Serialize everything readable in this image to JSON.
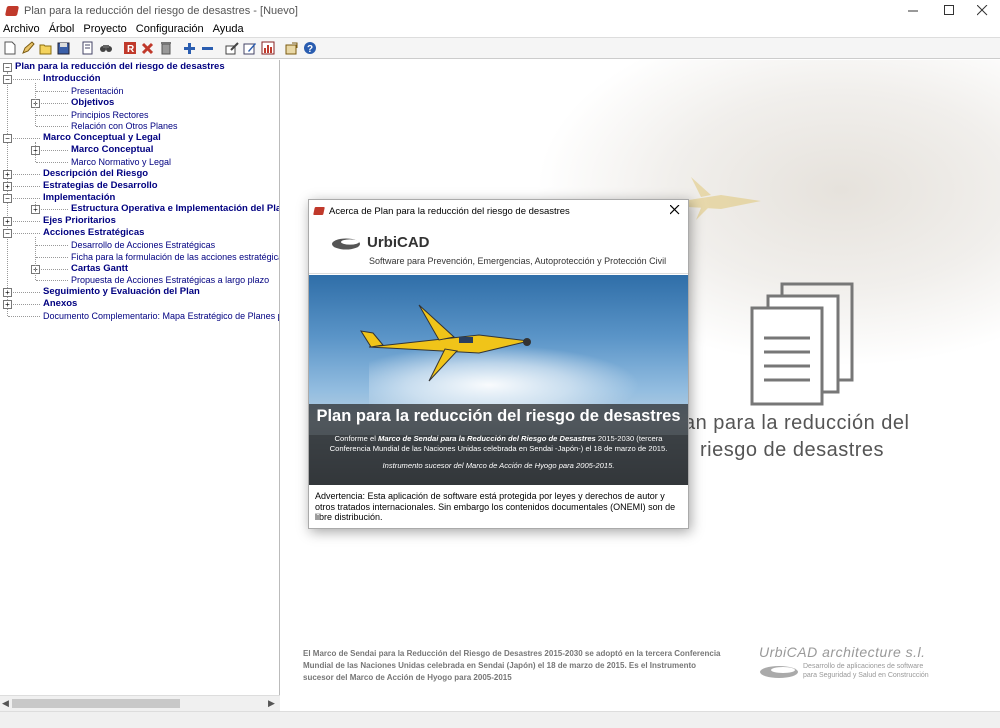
{
  "window": {
    "title": "Plan para la reducción del riesgo de desastres - [Nuevo]"
  },
  "menu": [
    "Archivo",
    "Árbol",
    "Proyecto",
    "Configuración",
    "Ayuda"
  ],
  "toolbar": {
    "buttons": [
      "new-icon",
      "edit-icon",
      "open-icon",
      "save-icon",
      "preview-icon",
      "find-icon",
      "report-icon",
      "delete-icon",
      "trash-icon",
      "add-icon",
      "remove-icon",
      "tool-icon",
      "pencil-icon",
      "chart-icon",
      "export-icon",
      "help-icon"
    ]
  },
  "tree": {
    "root": "Plan para la reducción del riesgo de desastres",
    "items": [
      {
        "label": "Introducción",
        "level": 1,
        "bold": true,
        "expander": "-"
      },
      {
        "label": "Presentación",
        "level": 2,
        "bold": false,
        "expander": ""
      },
      {
        "label": "Objetivos",
        "level": 2,
        "bold": true,
        "expander": "+"
      },
      {
        "label": "Principios Rectores",
        "level": 2,
        "bold": false,
        "expander": ""
      },
      {
        "label": "Relación con Otros Planes",
        "level": 2,
        "bold": false,
        "expander": ""
      },
      {
        "label": "Marco Conceptual y Legal",
        "level": 1,
        "bold": true,
        "expander": "-"
      },
      {
        "label": "Marco Conceptual",
        "level": 2,
        "bold": true,
        "expander": "+"
      },
      {
        "label": "Marco Normativo y Legal",
        "level": 2,
        "bold": false,
        "expander": ""
      },
      {
        "label": "Descripción del Riesgo",
        "level": 1,
        "bold": true,
        "expander": "+"
      },
      {
        "label": "Estrategias de Desarrollo",
        "level": 1,
        "bold": true,
        "expander": "+"
      },
      {
        "label": "Implementación",
        "level": 1,
        "bold": true,
        "expander": "-"
      },
      {
        "label": "Estructura Operativa e Implementación del Plan p",
        "level": 2,
        "bold": true,
        "expander": "+"
      },
      {
        "label": "Ejes Prioritarios",
        "level": 1,
        "bold": true,
        "expander": "+"
      },
      {
        "label": "Acciones Estratégicas",
        "level": 1,
        "bold": true,
        "expander": "-"
      },
      {
        "label": "Desarrollo de Acciones Estratégicas",
        "level": 2,
        "bold": false,
        "expander": ""
      },
      {
        "label": "Ficha para la formulación de las acciones estratégicas",
        "level": 2,
        "bold": false,
        "expander": ""
      },
      {
        "label": "Cartas Gantt",
        "level": 2,
        "bold": true,
        "expander": "+"
      },
      {
        "label": "Propuesta de Acciones Estratégicas a largo plazo",
        "level": 2,
        "bold": false,
        "expander": ""
      },
      {
        "label": "Seguimiento y Evaluación del Plan",
        "level": 1,
        "bold": true,
        "expander": "+"
      },
      {
        "label": "Anexos",
        "level": 1,
        "bold": true,
        "expander": "+"
      },
      {
        "label": "Documento Complementario: Mapa Estratégico de Planes para La G",
        "level": 1,
        "bold": false,
        "expander": ""
      }
    ]
  },
  "background": {
    "title_line1": "an para la reducción del",
    "title_line2": "riesgo de desastres",
    "description": "El Marco de Sendai para la Reducción del Riesgo de Desastres 2015-2030 se adoptó en la tercera Conferencia Mundial de las Naciones Unidas celebrada en Sendai (Japón) el 18 de marzo de 2015. Es el Instrumento sucesor del Marco de Acción de Hyogo para 2005-2015",
    "brand_name": "UrbiCAD architecture s.l.",
    "brand_sub1": "Desarrollo de aplicaciones de software",
    "brand_sub2": "para Seguridad y Salud en Construcción"
  },
  "dialog": {
    "title": "Acerca de Plan para la reducción del riesgo de desastres",
    "brand": "UrbiCAD",
    "slogan": "Software para Prevención, Emergencias, Autoprotección y Protección Civil",
    "banner_title": "Plan para la reducción del riesgo de desastres",
    "banner_text_pre": "Conforme el ",
    "banner_text_bold": "Marco de Sendai para la Reducción del Riesgo de Desastres",
    "banner_text_post": " 2015-2030 (tercera Conferencia Mundial de las Naciones Unidas celebrada en Sendai -Japón-) el 18 de marzo de 2015.",
    "banner_sub": "Instrumento sucesor del Marco de Acción de Hyogo para 2005-2015.",
    "warning": "Advertencia: Esta aplicación de software está protegida por leyes y derechos de autor y otros tratados internacionales. Sin embargo los contenidos documentales (ONEMI) son de libre distribución."
  }
}
